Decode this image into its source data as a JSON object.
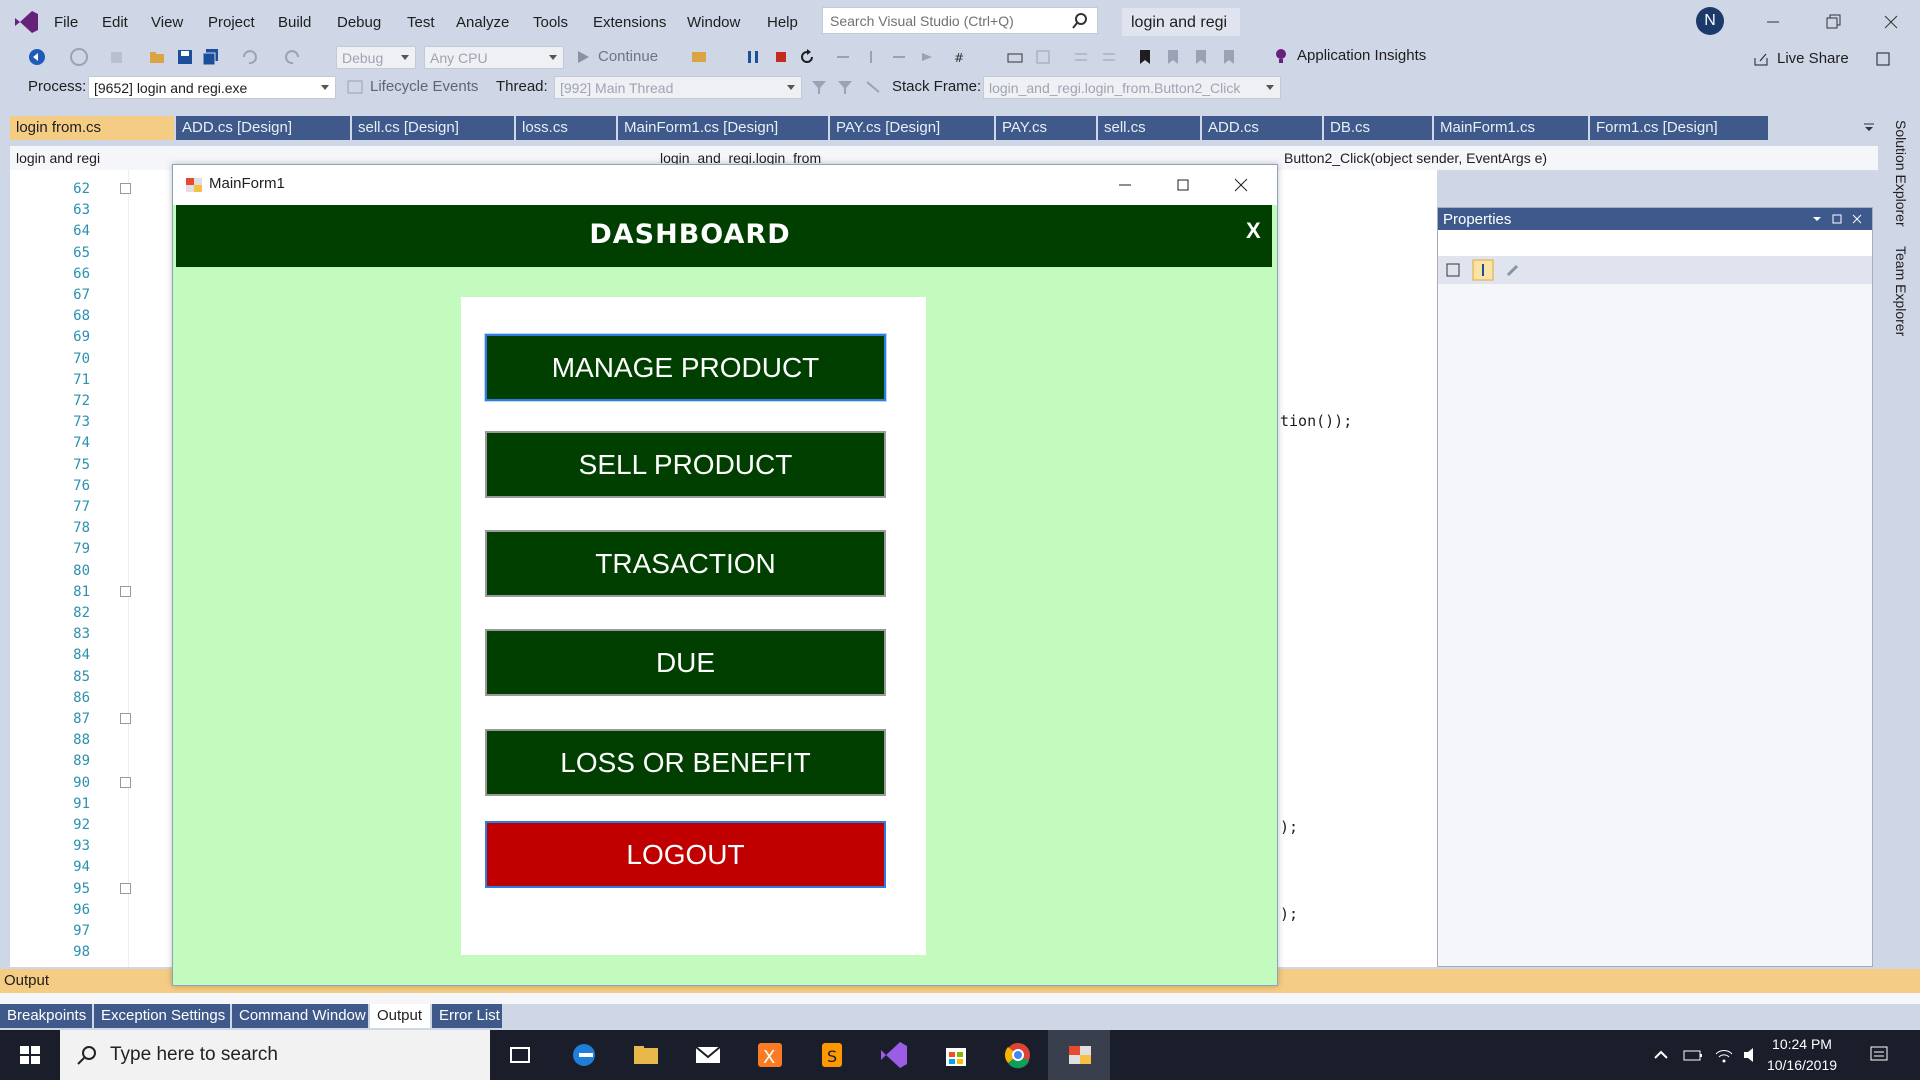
{
  "menubar": {
    "items": [
      "File",
      "Edit",
      "View",
      "Project",
      "Build",
      "Debug",
      "Test",
      "Analyze",
      "Tools",
      "Extensions",
      "Window",
      "Help"
    ],
    "search_placeholder": "Search Visual Studio (Ctrl+Q)",
    "solution_name": "login and regi",
    "avatar_initial": "N"
  },
  "toolbar1": {
    "config": "Debug",
    "platform": "Any CPU",
    "continue_label": "Continue",
    "app_insights": "Application Insights",
    "live_share": "Live Share"
  },
  "toolbar2": {
    "process_label": "Process:",
    "process_value": "[9652] login and regi.exe",
    "lifecycle": "Lifecycle Events",
    "thread_label": "Thread:",
    "thread_value": "[992] Main Thread",
    "stack_label": "Stack Frame:",
    "stack_value": "login_and_regi.login_from.Button2_Click"
  },
  "tabs": [
    {
      "label": "login from.cs",
      "active": true
    },
    {
      "label": "ADD.cs [Design]"
    },
    {
      "label": "sell.cs [Design]"
    },
    {
      "label": "loss.cs"
    },
    {
      "label": "MainForm1.cs [Design]"
    },
    {
      "label": "PAY.cs [Design]"
    },
    {
      "label": "PAY.cs"
    },
    {
      "label": "sell.cs"
    },
    {
      "label": "ADD.cs"
    },
    {
      "label": "DB.cs"
    },
    {
      "label": "MainForm1.cs"
    },
    {
      "label": "Form1.cs [Design]"
    }
  ],
  "navbar": {
    "project": "login and regi",
    "class": "login_and_regi.login_from",
    "member": "Button2_Click(object sender, EventArgs e)"
  },
  "line_numbers": [
    "62",
    "63",
    "64",
    "65",
    "66",
    "67",
    "68",
    "69",
    "70",
    "71",
    "72",
    "73",
    "74",
    "75",
    "76",
    "77",
    "78",
    "79",
    "80",
    "81",
    "82",
    "83",
    "84",
    "85",
    "86",
    "87",
    "88",
    "89",
    "90",
    "91",
    "92",
    "93",
    "94",
    "95",
    "96",
    "97",
    "98"
  ],
  "code_fragments": {
    "line73": "tion());",
    "line92": ");",
    "line97": ");"
  },
  "properties": {
    "title": "Properties"
  },
  "rightdock": {
    "solution_explorer": "Solution Explorer",
    "team_explorer": "Team Explorer"
  },
  "output": {
    "title": "Output"
  },
  "bottom_tabs": [
    {
      "label": "Breakpoints"
    },
    {
      "label": "Exception Settings"
    },
    {
      "label": "Command Window"
    },
    {
      "label": "Output",
      "active": true
    },
    {
      "label": "Error List"
    }
  ],
  "taskbar": {
    "search_placeholder": "Type here to search",
    "time": "10:24 PM",
    "date": "10/16/2019"
  },
  "form": {
    "title": "MainForm1",
    "header": "DASHBOARD",
    "close_x": "X",
    "buttons": {
      "manage": "MANAGE PRODUCT",
      "sell": "SELL PRODUCT",
      "transaction": "TRASACTION",
      "due": "DUE",
      "loss": "LOSS OR BENEFIT",
      "logout": "LOGOUT"
    }
  },
  "colors": {
    "form_bg": "#c2fbbd",
    "header_bg": "#003f00",
    "button_bg": "#003f00",
    "logout_bg": "#c00000",
    "active_tab": "#f5cc84"
  }
}
